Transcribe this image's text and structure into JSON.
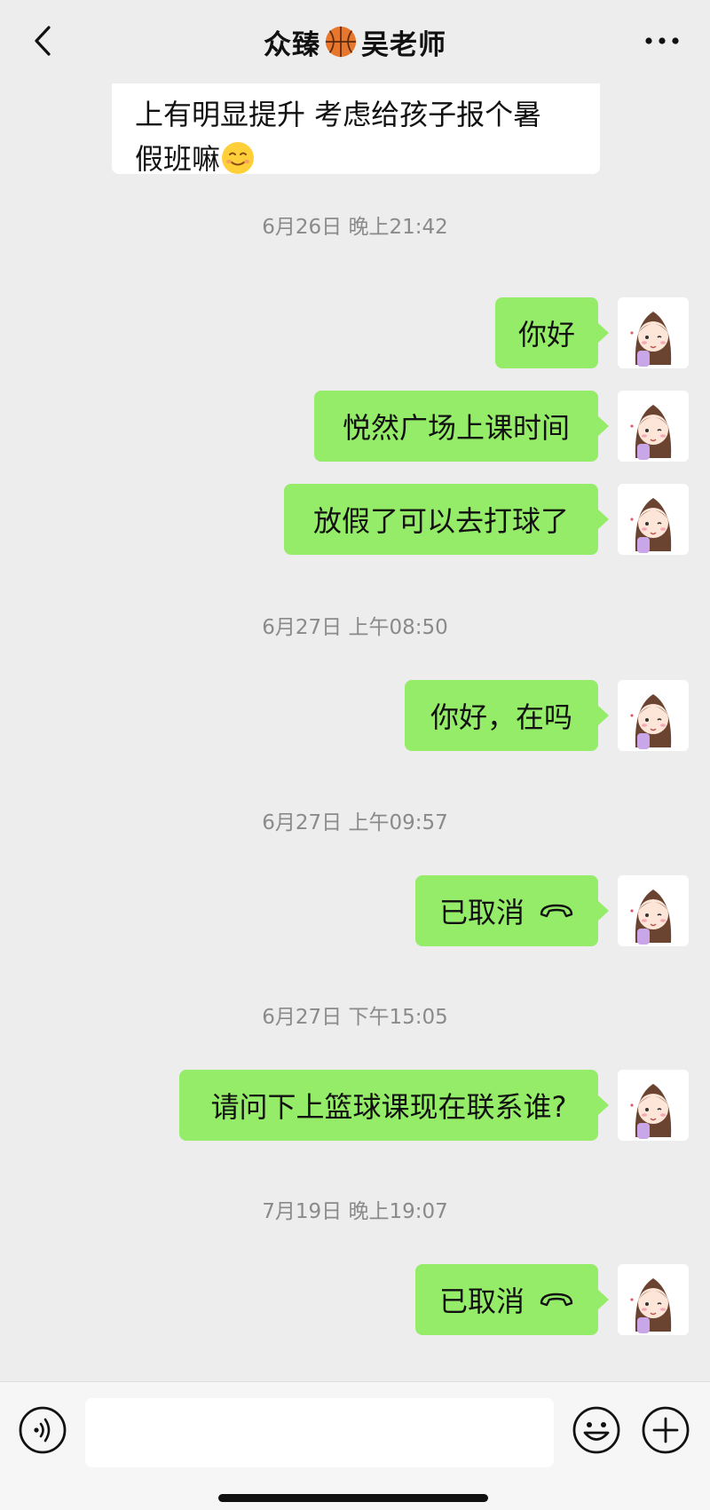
{
  "header": {
    "title_prefix": "众臻",
    "title_suffix": "吴老师"
  },
  "incoming_message": {
    "line1": "上有明显提升 考虑给孩子报个暑",
    "line2": "假班嘛"
  },
  "messages": [
    {
      "type": "timestamp",
      "text": "6月26日 晚上21:42"
    },
    {
      "type": "outgoing",
      "text": "你好"
    },
    {
      "type": "outgoing",
      "text": "悦然广场上课时间"
    },
    {
      "type": "outgoing",
      "text": "放假了可以去打球了"
    },
    {
      "type": "timestamp",
      "text": "6月27日 上午08:50"
    },
    {
      "type": "outgoing",
      "text": "你好，在吗"
    },
    {
      "type": "timestamp",
      "text": "6月27日 上午09:57"
    },
    {
      "type": "outgoing_call",
      "text": "已取消"
    },
    {
      "type": "timestamp",
      "text": "6月27日 下午15:05"
    },
    {
      "type": "outgoing",
      "text": "请问下上篮球课现在联系谁?"
    },
    {
      "type": "timestamp",
      "text": "7月19日 晚上19:07"
    },
    {
      "type": "outgoing_call",
      "text": "已取消"
    }
  ],
  "input_bar": {
    "placeholder": ""
  },
  "icons": {
    "back": "chevron-left-icon",
    "more": "more-dots-icon",
    "title_emoji": "basketball-icon",
    "incoming_emoji": "smile-emoji-icon",
    "call": "hang-up-phone-icon",
    "voice": "voice-icon",
    "emoji": "emoji-icon",
    "plus": "plus-icon"
  },
  "colors": {
    "background": "#ededed",
    "outgoing_bubble": "#95ec69",
    "incoming_bubble": "#ffffff",
    "timestamp": "#8a8a8a"
  }
}
